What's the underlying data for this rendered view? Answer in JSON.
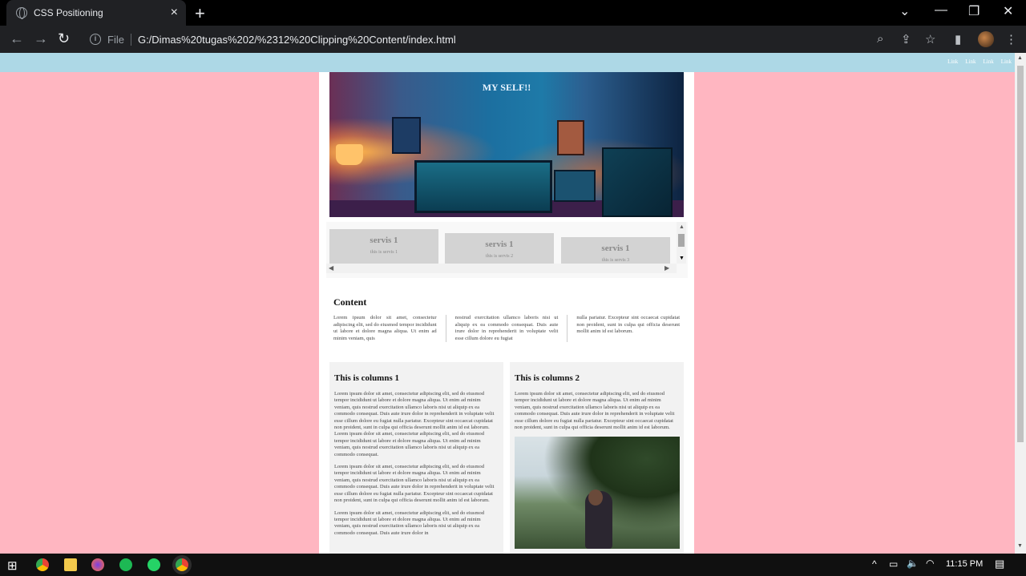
{
  "browser": {
    "tab_title": "CSS Positioning",
    "tab_close": "×",
    "new_tab": "+",
    "file_label": "File",
    "url": "G:/Dimas%20tugas%202/%2312%20Clipping%20Content/index.html"
  },
  "page": {
    "nav_links": [
      "Link",
      "Link",
      "Link",
      "Link"
    ],
    "hero_title": "MY SELF!!",
    "servis": [
      {
        "title": "servis 1",
        "text": "this is servis 1"
      },
      {
        "title": "servis 1",
        "text": "this is servis 2"
      },
      {
        "title": "servis 1",
        "text": "this is servis 3"
      }
    ],
    "content_heading": "Content",
    "content_columns": [
      "Lorem ipsum dolor sit amet, consectetur adipiscing elit, sed do eiusmod tempor incididunt ut labore et dolore magna aliqua. Ut enim ad minim veniam, quis",
      "nostrud exercitation ullamco laboris nisi ut aliquip ex ea commodo consequat. Duis aute irure dolor in reprehenderit in voluptate velit esse cillum dolore eu fugiat",
      "nulla pariatur. Excepteur sint occaecat cupidatat non proident, sunt in culpa qui officia deserunt mollit anim id est laborum."
    ],
    "column1": {
      "title": "This is columns 1",
      "paragraphs": [
        "Lorem ipsum dolor sit amet, consectetur adipiscing elit, sed do eiusmod tempor incididunt ut labore et dolore magna aliqua. Ut enim ad minim veniam, quis nostrud exercitation ullamco laboris nisi ut aliquip ex ea commodo consequat. Duis aute irure dolor in reprehenderit in voluptate velit esse cillum dolore eu fugiat nulla pariatur. Excepteur sint occaecat cupidatat non proident, sunt in culpa qui officia deserunt mollit anim id est laborum. Lorem ipsum dolor sit amet, consectetur adipiscing elit, sed do eiusmod tempor incididunt ut labore et dolore magna aliqua. Ut enim ad minim veniam, quis nostrud exercitation ullamco laboris nisi ut aliquip ex ea commodo consequat.",
        "Lorem ipsum dolor sit amet, consectetur adipiscing elit, sed do eiusmod tempor incididunt ut labore et dolore magna aliqua. Ut enim ad minim veniam, quis nostrud exercitation ullamco laboris nisi ut aliquip ex ea commodo consequat. Duis aute irure dolor in reprehenderit in voluptate velit esse cillum dolore eu fugiat nulla pariatur. Excepteur sint occaecat cupidatat non proident, sunt in culpa qui officia deserunt mollit anim id est laborum.",
        "Lorem ipsum dolor sit amet, consectetur adipiscing elit, sed do eiusmod tempor incididunt ut labore et dolore magna aliqua. Ut enim ad minim veniam, quis nostrud exercitation ullamco laboris nisi ut aliquip ex ea commodo consequat. Duis aute irure dolor in"
      ]
    },
    "column2": {
      "title": "This is columns 2",
      "paragraph": "Lorem ipsum dolor sit amet, consectetur adipiscing elit, sed do eiusmod tempor incididunt ut labore et dolore magna aliqua. Ut enim ad minim veniam, quis nostrud exercitation ullamco laboris nisi ut aliquip ex ea commodo consequat. Duis aute irure dolor in reprehenderit in voluptate velit esse cillum dolore eu fugiat nulla pariatur. Excepteur sint occaecat cupidatat non proident, sunt in culpa qui officia deserunt mollit anim id est laborum."
    },
    "colors": {
      "page_background": "#ffb6c1",
      "nav_background": "#add8e6",
      "servis_box": "#d3d3d3"
    }
  },
  "taskbar": {
    "time": "11:15 PM"
  }
}
